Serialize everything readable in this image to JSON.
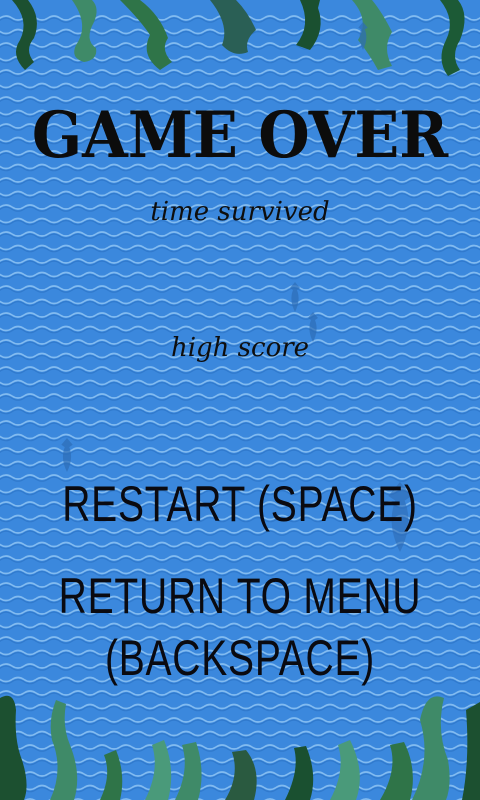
{
  "title": "GAME OVER",
  "time_label": "time survived",
  "score_label": "high score",
  "buttons": {
    "restart": "RESTART (SPACE)",
    "menu_line1": "RETURN TO MENU",
    "menu_line2": "(BACKSPACE)"
  },
  "colors": {
    "water": "#3b88dd",
    "wave": "#8fc4f3",
    "text": "#0c0c0c",
    "seaweed_dark": "#1f5a34",
    "seaweed_mid": "#2f7a52",
    "seaweed_light": "#4a9a7a"
  }
}
